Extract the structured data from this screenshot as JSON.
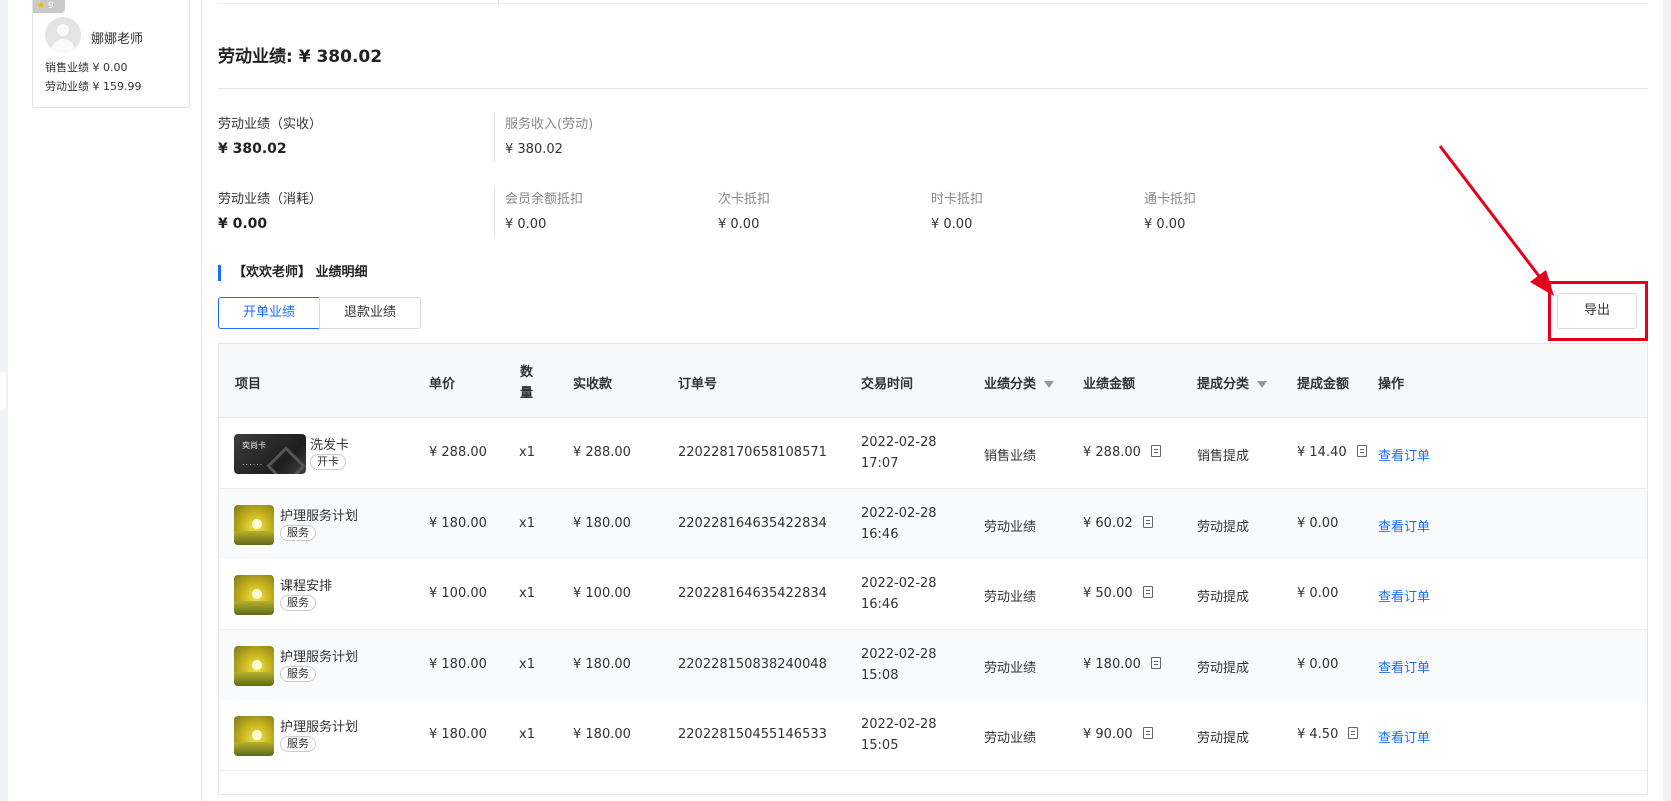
{
  "sidebar": {
    "teacher_card": {
      "rank": "9",
      "name": "娜娜老师",
      "sales": "销售业绩 ¥ 0.00",
      "labor": "劳动业绩 ¥ 159.99"
    }
  },
  "header": {
    "performance_title": "劳动业绩: ¥ 380.02"
  },
  "summary": {
    "actual": {
      "label": "劳动业绩（实收）",
      "value": "¥ 380.02",
      "items": [
        {
          "label": "服务收入(劳动)",
          "value": "¥ 380.02"
        }
      ]
    },
    "consumption": {
      "label": "劳动业绩（消耗）",
      "value": "¥ 0.00",
      "items": [
        {
          "label": "会员余额抵扣",
          "value": "¥ 0.00"
        },
        {
          "label": "次卡抵扣",
          "value": "¥ 0.00"
        },
        {
          "label": "时卡抵扣",
          "value": "¥ 0.00"
        },
        {
          "label": "通卡抵扣",
          "value": "¥ 0.00"
        }
      ]
    }
  },
  "detail": {
    "title": "【欢欢老师】 业绩明细",
    "tabs": [
      {
        "label": "开单业绩",
        "active": true
      },
      {
        "label": "退款业绩",
        "active": false
      }
    ],
    "export_label": "导出"
  },
  "table": {
    "columns": {
      "item": "项目",
      "price": "单价",
      "qty_line1": "数",
      "qty_line2": "量",
      "paid": "实收款",
      "order_no": "订单号",
      "time": "交易时间",
      "perf_type": "业绩分类",
      "perf_amount": "业绩金额",
      "comm_type": "提成分类",
      "comm_amount": "提成金额",
      "action": "操作"
    },
    "rows": [
      {
        "thumb": "card",
        "thumb_brand": "奕尚卡",
        "thumb_dots": "......",
        "name": "洗发卡",
        "tag": "开卡",
        "price": "¥ 288.00",
        "qty": "x1",
        "paid": "¥ 288.00",
        "order_no": "220228170658108571",
        "date": "2022-02-28",
        "time": "17:07",
        "perf_type": "销售业绩",
        "perf_amount": "¥ 288.00",
        "comm_type": "销售提成",
        "comm_amount": "¥ 14.40",
        "comm_has_icon": true,
        "action": "查看订单"
      },
      {
        "thumb": "service",
        "name": "护理服务计划",
        "tag": "服务",
        "price": "¥ 180.00",
        "qty": "x1",
        "paid": "¥ 180.00",
        "order_no": "220228164635422834",
        "date": "2022-02-28",
        "time": "16:46",
        "perf_type": "劳动业绩",
        "perf_amount": "¥ 60.02",
        "comm_type": "劳动提成",
        "comm_amount": "¥ 0.00",
        "comm_has_icon": false,
        "action": "查看订单"
      },
      {
        "thumb": "service",
        "name": "课程安排",
        "tag": "服务",
        "price": "¥ 100.00",
        "qty": "x1",
        "paid": "¥ 100.00",
        "order_no": "220228164635422834",
        "date": "2022-02-28",
        "time": "16:46",
        "perf_type": "劳动业绩",
        "perf_amount": "¥ 50.00",
        "comm_type": "劳动提成",
        "comm_amount": "¥ 0.00",
        "comm_has_icon": false,
        "action": "查看订单"
      },
      {
        "thumb": "service",
        "name": "护理服务计划",
        "tag": "服务",
        "price": "¥ 180.00",
        "qty": "x1",
        "paid": "¥ 180.00",
        "order_no": "220228150838240048",
        "date": "2022-02-28",
        "time": "15:08",
        "perf_type": "劳动业绩",
        "perf_amount": "¥ 180.00",
        "comm_type": "劳动提成",
        "comm_amount": "¥ 0.00",
        "comm_has_icon": false,
        "action": "查看订单"
      },
      {
        "thumb": "service",
        "name": "护理服务计划",
        "tag": "服务",
        "price": "¥ 180.00",
        "qty": "x1",
        "paid": "¥ 180.00",
        "order_no": "220228150455146533",
        "date": "2022-02-28",
        "time": "15:05",
        "perf_type": "劳动业绩",
        "perf_amount": "¥ 90.00",
        "comm_type": "劳动提成",
        "comm_amount": "¥ 4.50",
        "comm_has_icon": true,
        "action": "查看订单"
      }
    ]
  },
  "colors": {
    "accent": "#1a6dff",
    "annotation_red": "#e4001b"
  }
}
